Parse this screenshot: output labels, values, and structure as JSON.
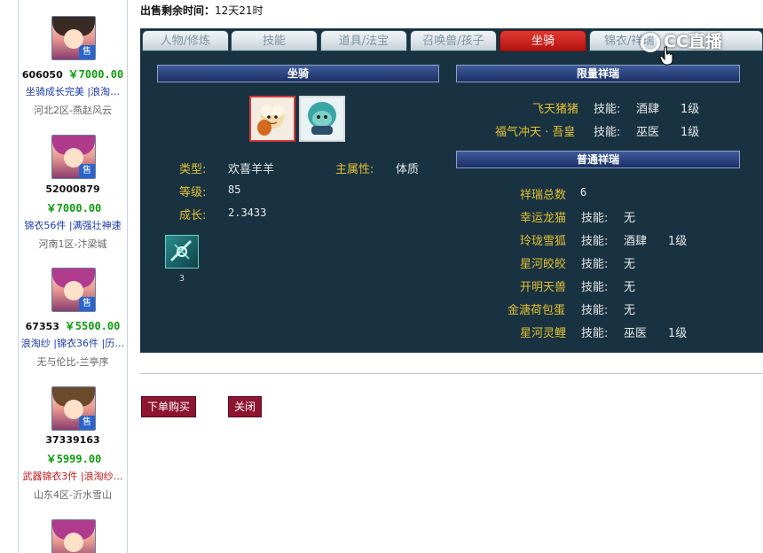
{
  "sidebar": {
    "listings": [
      {
        "id": "606050",
        "price": "￥7000.00",
        "desc": "坐骑成长完美 |浪淘…",
        "server": "河北2区-燕赵风云",
        "desc_color": "blue",
        "avatar": "boy"
      },
      {
        "id": "52000879",
        "price": "￥7000.00",
        "desc": "锦衣56件 |满强壮神速",
        "server": "河南1区-汴梁城",
        "desc_color": "blue",
        "avatar": "girl"
      },
      {
        "id": "67353",
        "price": "￥5500.00",
        "desc": "浪淘纱 |锦衣36件 |历…",
        "server": "无与伦比-兰亭序",
        "desc_color": "blue",
        "avatar": "girl"
      },
      {
        "id": "37339163",
        "price": "￥5999.00",
        "desc": "武器锦衣3件 |浪淘纱…",
        "server": "山东4区-沂水雪山",
        "desc_color": "red",
        "avatar": "boy2"
      }
    ],
    "sell_badge": "售"
  },
  "header": {
    "time_label": "出售剩余时间：",
    "time_value": "12天21时"
  },
  "tabs": [
    {
      "label": "人物/修炼"
    },
    {
      "label": "技能"
    },
    {
      "label": "道具/法宝"
    },
    {
      "label": "召唤兽/孩子"
    },
    {
      "label": "坐骑",
      "active": true
    },
    {
      "label": "锦衣/祥瑞"
    }
  ],
  "mount": {
    "title": "坐骑",
    "type_label": "类型:",
    "type_value": "欢喜羊羊",
    "attr_label": "主属性:",
    "attr_value": "体质",
    "level_label": "等级:",
    "level_value": "85",
    "growth_label": "成长:",
    "growth_value": "2.3433",
    "item_count": "3"
  },
  "limited": {
    "title": "限量祥瑞",
    "items": [
      {
        "name": "飞天猪猪",
        "skill_label": "技能:",
        "skill": "酒肆",
        "level": "1级"
      },
      {
        "name": "福气冲天 · 吾皇",
        "skill_label": "技能:",
        "skill": "巫医",
        "level": "1级"
      }
    ]
  },
  "normal": {
    "title": "普通祥瑞",
    "total_label": "祥瑞总数",
    "total_value": "6",
    "items": [
      {
        "name": "幸运龙猫",
        "skill_label": "技能:",
        "skill": "无",
        "level": ""
      },
      {
        "name": "玲珑雪狐",
        "skill_label": "技能:",
        "skill": "酒肆",
        "level": "1级"
      },
      {
        "name": "星河皎皎",
        "skill_label": "技能:",
        "skill": "无",
        "level": ""
      },
      {
        "name": "开明天兽",
        "skill_label": "技能:",
        "skill": "无",
        "level": ""
      },
      {
        "name": "金溏荷包蛋",
        "skill_label": "技能:",
        "skill": "无",
        "level": ""
      },
      {
        "name": "星河灵鲤",
        "skill_label": "技能:",
        "skill": "巫医",
        "level": "1级"
      }
    ]
  },
  "actions": {
    "buy_label": "下单购买",
    "close_label": "关闭"
  },
  "watermark": {
    "text": "CC直播"
  }
}
